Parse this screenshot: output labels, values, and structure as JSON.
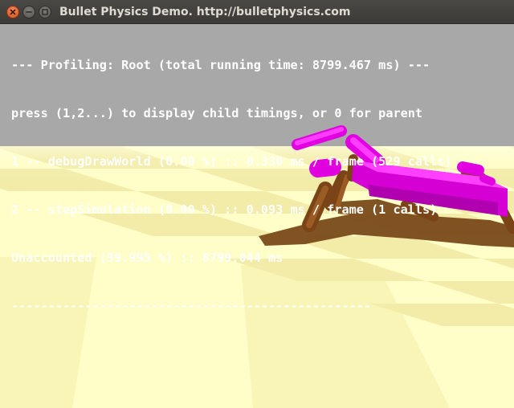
{
  "window": {
    "title": "Bullet Physics Demo. http://bulletphysics.com"
  },
  "profiling": {
    "lines": [
      "--- Profiling: Root (total running time: 8799.467 ms) ---",
      "press (1,2...) to display child timings, or 0 for parent",
      "1 -- debugDrawWorld (0.00 %) :: 0.330 ms / frame (529 calls)",
      "2 -- stepSimulation (0.00 %) :: 0.093 ms / frame (1 calls)",
      "Unaccounted (99.995 %) :: 8799.044 ms",
      "-------------------------------------------------"
    ]
  },
  "scene": {
    "sky_color": "#a8a8a8",
    "floor_light": "#fffec8",
    "floor_dark": "#efeaa6",
    "body_color": "#ff00ff",
    "leg_color": "#8a4f1d",
    "shadow_color": "#7a4a1a"
  }
}
